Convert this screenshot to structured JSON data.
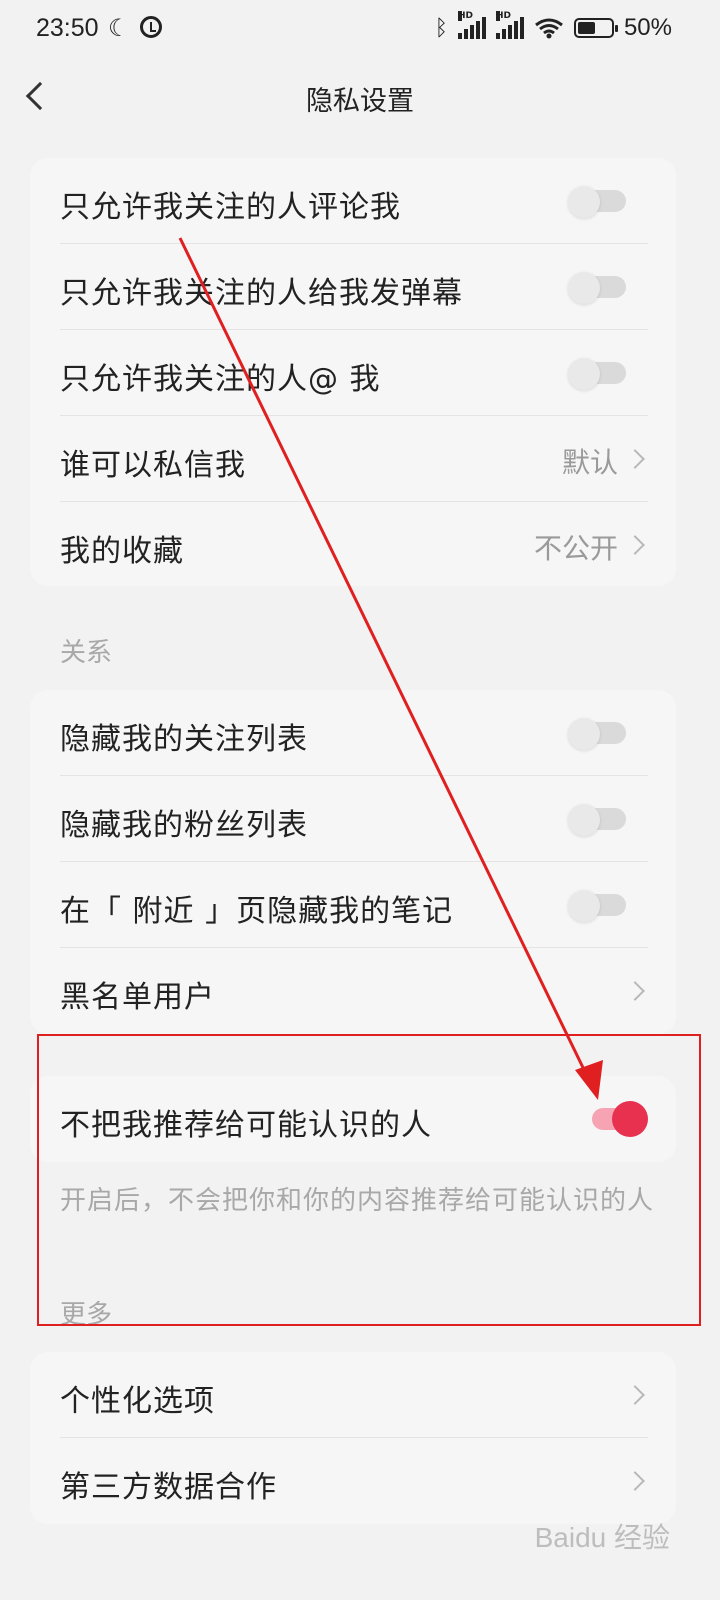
{
  "status_bar": {
    "time": "23:50",
    "battery": "50%",
    "hd1": "HD",
    "hd2": "HD"
  },
  "nav": {
    "title": "隐私设置"
  },
  "card1": {
    "rows": [
      {
        "label": "只允许我关注的人评论我",
        "toggle": false
      },
      {
        "label": "只允许我关注的人给我发弹幕",
        "toggle": false
      },
      {
        "label": "只允许我关注的人@ 我",
        "toggle": false
      },
      {
        "label": "谁可以私信我",
        "value": "默认"
      },
      {
        "label": "我的收藏",
        "value": "不公开"
      }
    ]
  },
  "relation": {
    "header": "关系",
    "rows": [
      {
        "label": "隐藏我的关注列表",
        "toggle": false
      },
      {
        "label": "隐藏我的粉丝列表",
        "toggle": false
      },
      {
        "label": "在「 附近 」页隐藏我的笔记",
        "toggle": false
      },
      {
        "label": "黑名单用户"
      }
    ]
  },
  "recommend": {
    "label": "不把我推荐给可能认识的人",
    "toggle": true,
    "description": "开启后，不会把你和你的内容推荐给可能认识的人"
  },
  "more": {
    "header": "更多",
    "rows": [
      {
        "label": "个性化选项"
      },
      {
        "label": "第三方数据合作"
      }
    ]
  },
  "watermark": "Baidu 经验",
  "colors": {
    "accent": "#e8304f",
    "annotation": "#e02020"
  }
}
